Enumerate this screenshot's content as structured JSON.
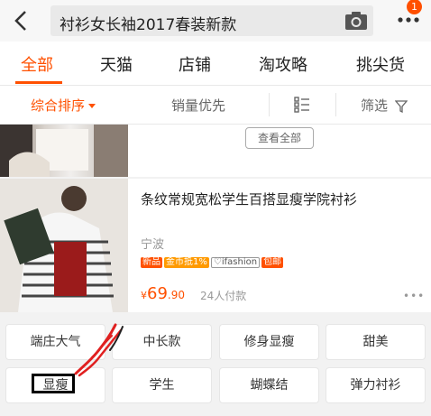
{
  "search": {
    "query": "衬衫女长袖2017春装新款"
  },
  "header": {
    "notification_count": "1"
  },
  "tabs": [
    {
      "label": "全部"
    },
    {
      "label": "天猫"
    },
    {
      "label": "店铺"
    },
    {
      "label": "淘攻略"
    },
    {
      "label": "挑尖货"
    }
  ],
  "sort": {
    "composite": "综合排序",
    "sales": "销量优先",
    "filter": "筛选"
  },
  "top_result": {
    "view_all": "查看全部"
  },
  "product": {
    "title": "条纹常规宽松学生百搭显瘦学院衬衫",
    "location": "宁波",
    "tags": [
      "新品",
      "金币抵1%",
      "♡ifashion",
      "包邮"
    ],
    "currency": "¥",
    "price_int": "69",
    "price_dec": ".90",
    "sold": "24人付款"
  },
  "filter_chips": [
    "端庄大气",
    "中长款",
    "修身显瘦",
    "甜美",
    "显瘦",
    "学生",
    "蝴蝶结",
    "弹力衬衫"
  ],
  "colors": {
    "accent": "#ff5000",
    "annotation": "#e02020"
  }
}
